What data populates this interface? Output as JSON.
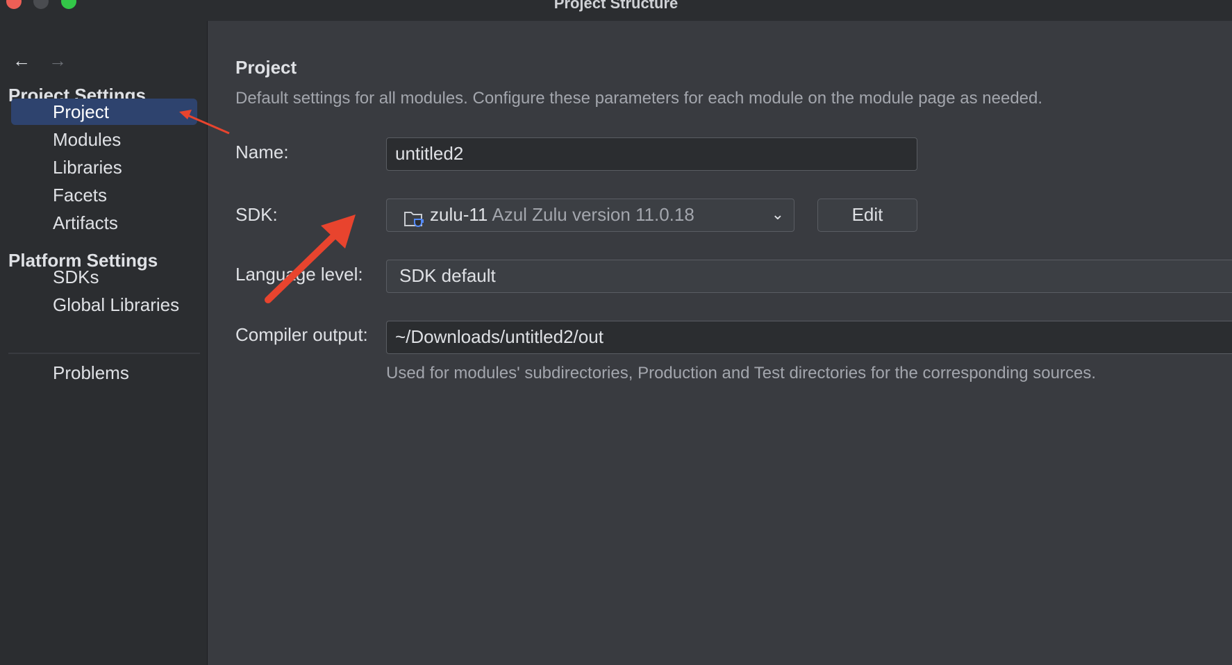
{
  "window": {
    "title": "Project Structure"
  },
  "nav": {
    "back_icon": "arrow-left-icon",
    "forward_icon": "arrow-right-icon"
  },
  "sidebar": {
    "project_settings_heading": "Project Settings",
    "items": [
      {
        "label": "Project",
        "selected": true
      },
      {
        "label": "Modules"
      },
      {
        "label": "Libraries"
      },
      {
        "label": "Facets"
      },
      {
        "label": "Artifacts"
      }
    ],
    "platform_settings_heading": "Platform Settings",
    "platform_items": [
      {
        "label": "SDKs"
      },
      {
        "label": "Global Libraries"
      }
    ],
    "problems_label": "Problems"
  },
  "main": {
    "title": "Project",
    "subtitle": "Default settings for all modules. Configure these parameters for each module on the module page as needed.",
    "name_label": "Name:",
    "name_value": "untitled2",
    "sdk_label": "SDK:",
    "sdk_name": "zulu-11",
    "sdk_description": "Azul Zulu version 11.0.18",
    "sdk_icon": "jdk-folder-icon",
    "edit_button": "Edit",
    "language_level_label": "Language level:",
    "language_level_value": "SDK default",
    "compiler_output_label": "Compiler output:",
    "compiler_output_value": "~/Downloads/untitled2/out",
    "compiler_output_hint": "Used for modules' subdirectories, Production and Test directories for the corresponding sources."
  },
  "colors": {
    "accent_selection": "#2e436e",
    "annotation_arrow": "#e8442e",
    "sidebar_bg": "#2b2d30",
    "content_bg": "#393b40"
  }
}
